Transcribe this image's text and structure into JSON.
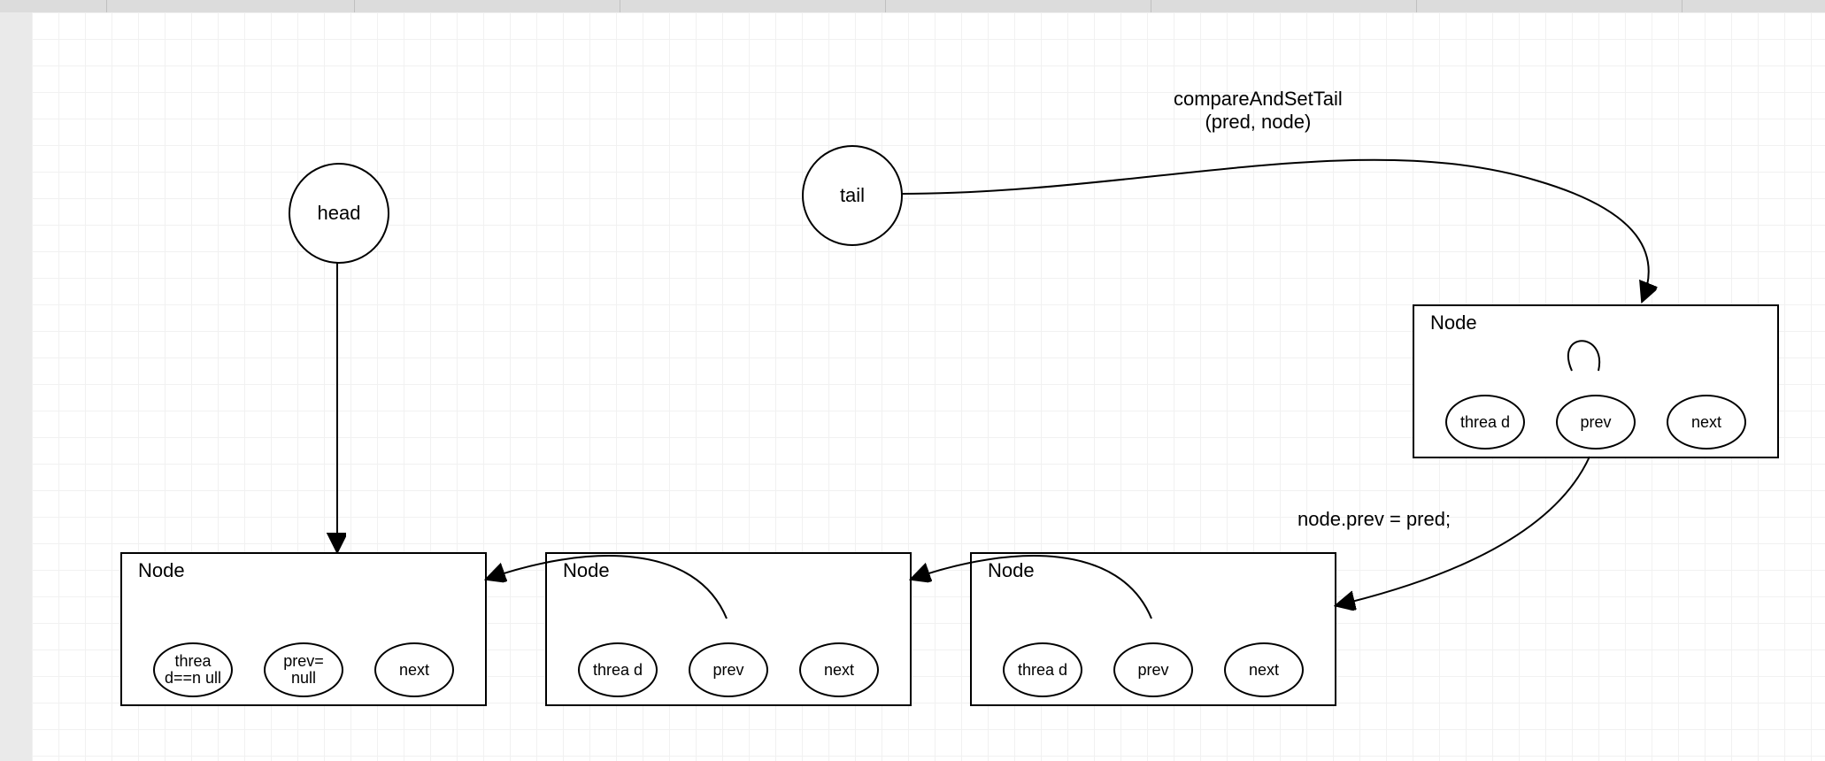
{
  "colors": {
    "stroke": "#000000",
    "grid": "#f1f1f1",
    "ruler": "#dcdcdc",
    "gutter": "#eaeaea"
  },
  "circles": {
    "head": {
      "label": "head"
    },
    "tail": {
      "label": "tail"
    }
  },
  "nodes": {
    "n1": {
      "title": "Node",
      "fields": {
        "thread": "threa d==n ull",
        "prev": "prev= null",
        "next": "next"
      }
    },
    "n2": {
      "title": "Node",
      "fields": {
        "thread": "threa d",
        "prev": "prev",
        "next": "next"
      }
    },
    "n3": {
      "title": "Node",
      "fields": {
        "thread": "threa d",
        "prev": "prev",
        "next": "next"
      }
    },
    "n4": {
      "title": "Node",
      "fields": {
        "thread": "threa d",
        "prev": "prev",
        "next": "next"
      }
    }
  },
  "edges": {
    "cas": {
      "label": "compareAndSetTail\n(pred, node)"
    },
    "nodeprev": {
      "label": "node.prev = pred;"
    }
  }
}
